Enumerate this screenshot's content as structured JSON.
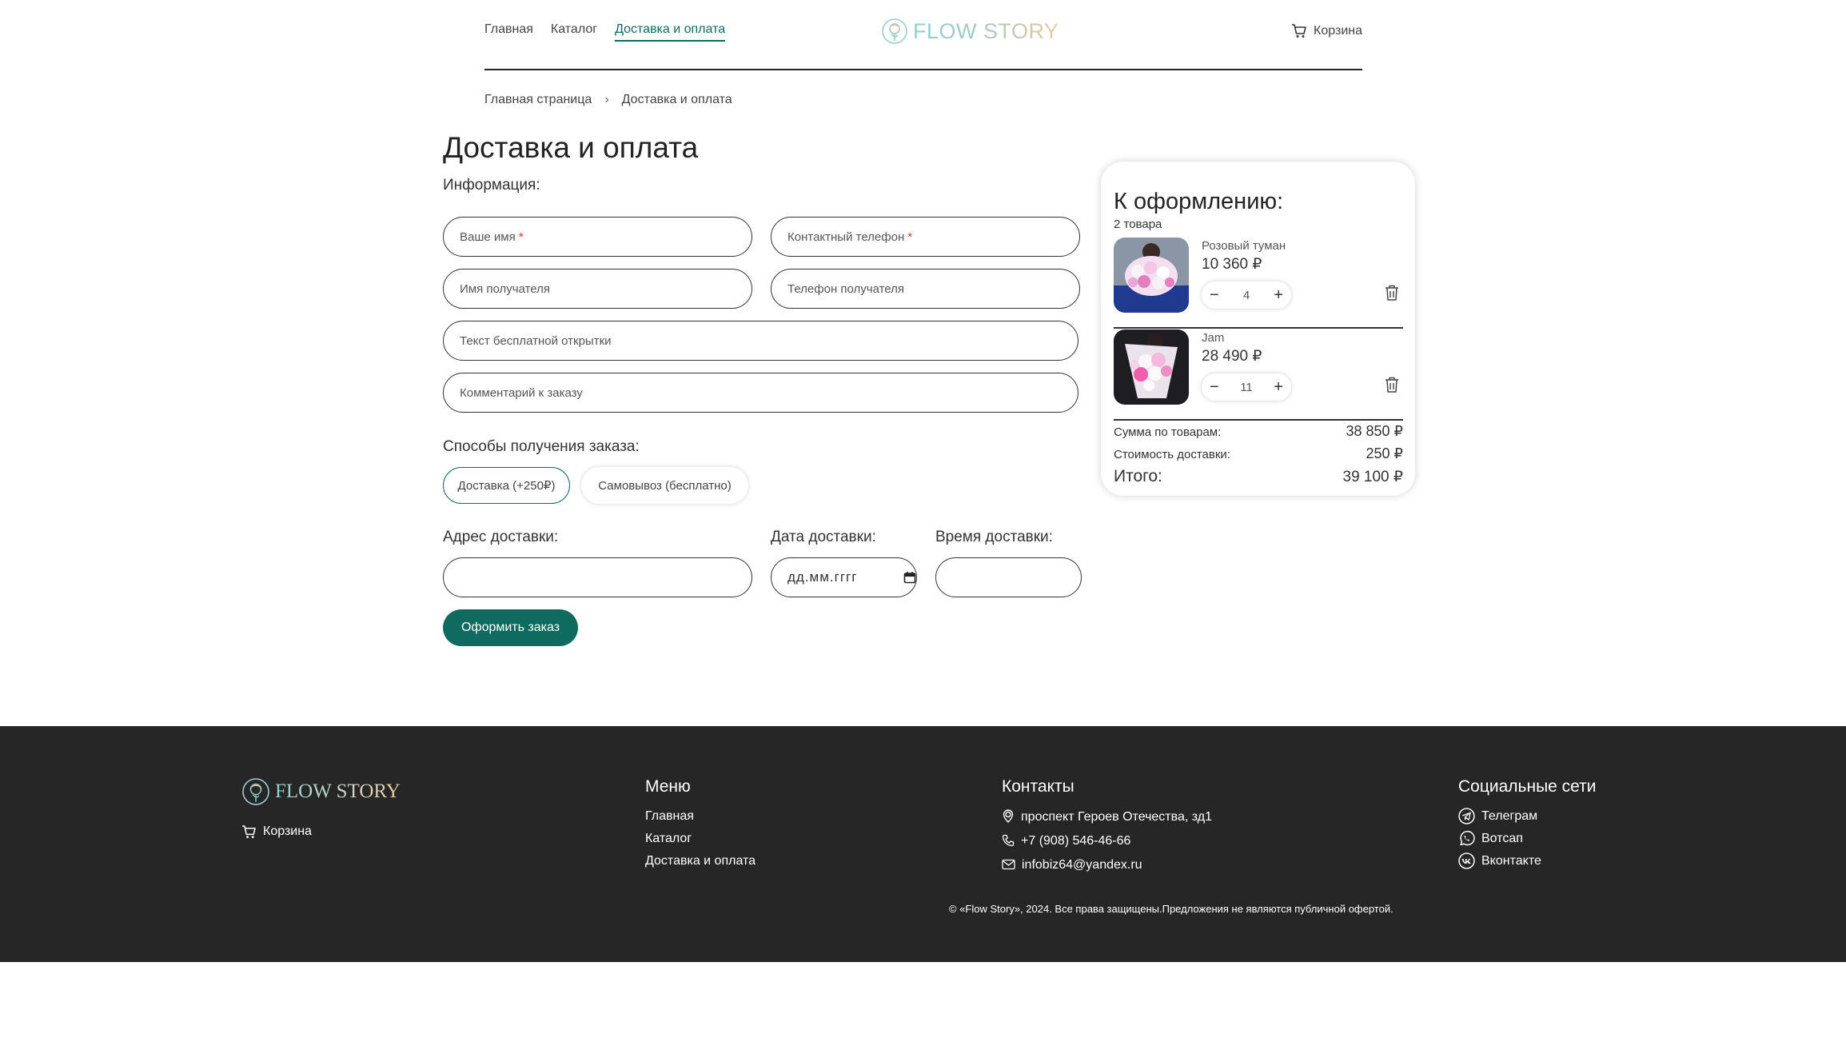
{
  "header": {
    "nav": [
      {
        "label": "Главная"
      },
      {
        "label": "Каталог"
      },
      {
        "label": "Доставка и оплата"
      }
    ],
    "logo_text": "FLOW STORY",
    "cart_label": "Корзина",
    "active_color": "#0f6b60"
  },
  "breadcrumb": {
    "home": "Главная страница",
    "separator": "›",
    "current": "Доставка и оплата"
  },
  "page_title": "Доставка и оплата",
  "info": {
    "label": "Информация:",
    "name_placeholder": "Ваше имя",
    "phone_placeholder": "Контактный телефон",
    "required_mark": "*",
    "recipient_name_placeholder": "Имя получателя",
    "recipient_phone_placeholder": "Телефон получателя",
    "card_text_placeholder": "Текст бесплатной открытки",
    "comment_placeholder": "Комментарий к заказу"
  },
  "delivery_methods": {
    "label": "Способы получения заказа:",
    "options": [
      {
        "label": "Доставка (+250₽)",
        "selected": true
      },
      {
        "label": "Самовывоз (бесплатно)",
        "selected": false
      }
    ]
  },
  "address": {
    "address_label": "Адрес доставки:",
    "address_value": "",
    "date_label": "Дата доставки:",
    "date_value": "дд.мм.гггг",
    "time_label": "Время доставки:",
    "time_value": ""
  },
  "submit_label": "Оформить заказ",
  "summary": {
    "title": "К оформлению:",
    "count": "2 товара",
    "items": [
      {
        "name": "Розовый туман",
        "price": "10 360 ₽",
        "qty": "4"
      },
      {
        "name": "Jam",
        "price": "28 490 ₽",
        "qty": "11"
      }
    ],
    "minus": "−",
    "plus": "+",
    "goods_label": "Сумма по товарам:",
    "goods_value": "38 850 ₽",
    "delivery_label": "Стоимость доставки:",
    "delivery_value": "250 ₽",
    "total_label": "Итого:",
    "total_value": "39 100 ₽"
  },
  "footer": {
    "logo_text": "FLOW STORY",
    "cart_label": "Корзина",
    "menu_title": "Меню",
    "menu": [
      "Главная",
      "Каталог",
      "Доставка и оплата"
    ],
    "contacts_title": "Контакты",
    "address": "проспект Героев Отечества, зд1",
    "phone": "+7 (908) 546-46-66",
    "email": "infobiz64@yandex.ru",
    "social_title": "Социальные сети",
    "social": [
      "Телеграм",
      "Вотсап",
      "Вконтакте"
    ],
    "copyright": "© «Flow Story», 2024. Все права защищены.Предложения не являются публичной офертой.",
    "background": "#262626"
  },
  "icons": {
    "cart": "cart-icon",
    "trash": "trash-icon",
    "calendar": "calendar-icon",
    "location": "location-icon",
    "phone": "phone-icon",
    "mail": "mail-icon",
    "telegram": "telegram-icon",
    "whatsapp": "whatsapp-icon",
    "vk": "vk-icon"
  }
}
